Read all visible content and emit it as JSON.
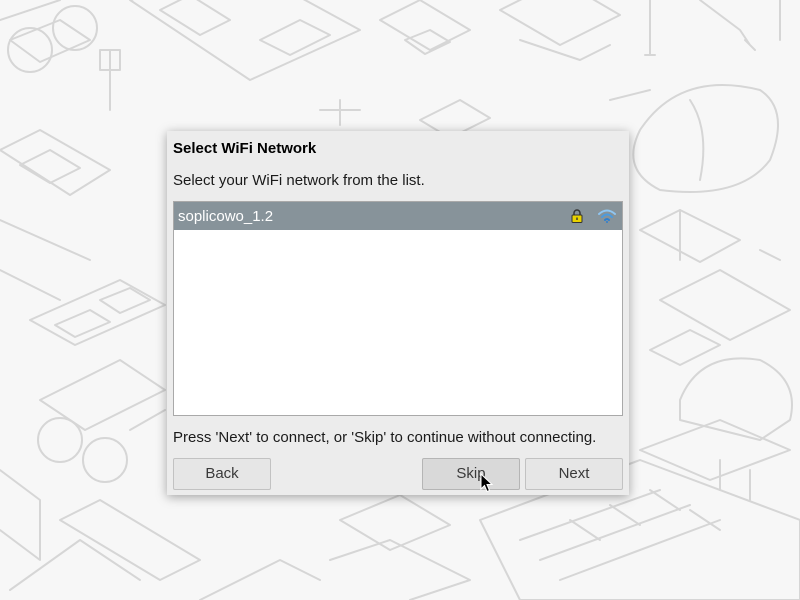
{
  "dialog": {
    "title": "Select WiFi Network",
    "instruction": "Select your WiFi network from the list.",
    "footer_text": "Press 'Next' to connect, or 'Skip' to continue without connecting."
  },
  "networks": [
    {
      "ssid": "soplicowo_1.2",
      "secured": true,
      "secured_icon": "lock-icon",
      "signal_icon": "wifi-signal-icon",
      "selected": true
    }
  ],
  "buttons": {
    "back_label": "Back",
    "skip_label": "Skip",
    "next_label": "Next"
  },
  "colors": {
    "selection": "#87939a",
    "dialog_bg": "#ececec",
    "lock": "#e8d200",
    "wifi": "#4a9be0"
  }
}
